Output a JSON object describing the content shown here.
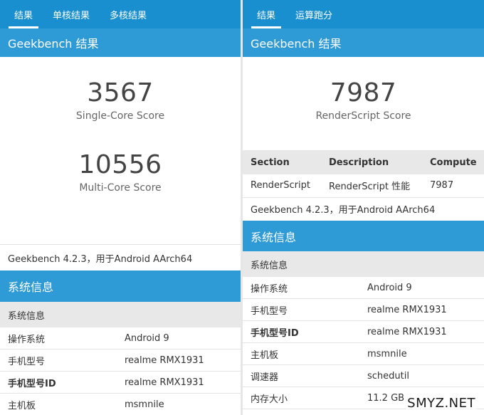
{
  "left": {
    "tabs": [
      "结果",
      "单核结果",
      "多核结果"
    ],
    "title": "Geekbench 结果",
    "single_core": {
      "value": "3567",
      "label": "Single-Core Score"
    },
    "multi_core": {
      "value": "10556",
      "label": "Multi-Core Score"
    },
    "version_line": "Geekbench 4.2.3，用于Android AArch64",
    "sysinfo_header": "系统信息",
    "sysinfo_subheader": "系统信息",
    "rows": [
      {
        "key": "操作系统",
        "value": "Android 9"
      },
      {
        "key": "手机型号",
        "value": "realme RMX1931"
      },
      {
        "key": "手机型号ID",
        "value": "realme RMX1931"
      },
      {
        "key": "主机板",
        "value": "msmnile"
      }
    ]
  },
  "right": {
    "tabs": [
      "结果",
      "运算跑分"
    ],
    "title": "Geekbench 结果",
    "score": {
      "value": "7987",
      "label": "RenderScript Score"
    },
    "table": {
      "headers": [
        "Section",
        "Description",
        "Compute"
      ],
      "rows": [
        [
          "RenderScript",
          "RenderScript 性能",
          "7987"
        ]
      ]
    },
    "version_line": "Geekbench 4.2.3，用于Android AArch64",
    "sysinfo_header": "系统信息",
    "sysinfo_subheader": "系统信息",
    "rows": [
      {
        "key": "操作系统",
        "value": "Android 9"
      },
      {
        "key": "手机型号",
        "value": "realme RMX1931"
      },
      {
        "key": "手机型号ID",
        "value": "realme RMX1931"
      },
      {
        "key": "主机板",
        "value": "msmnile"
      },
      {
        "key": "调速器",
        "value": "schedutil"
      },
      {
        "key": "内存大小",
        "value": "11.2 GB"
      }
    ]
  },
  "watermark": "SMYZ.NET"
}
